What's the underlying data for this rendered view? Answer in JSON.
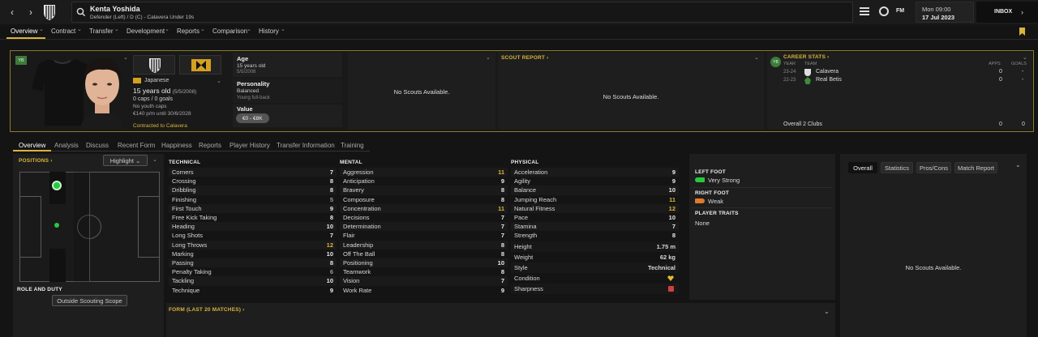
{
  "header": {
    "name": "Kenta Yoshida",
    "subtitle": "Defender (Left) / D (C) - Calavera Under 19s",
    "fm_label": "FM",
    "time": "Mon 09:00",
    "date": "17 Jul 2023",
    "inbox": "INBOX"
  },
  "subnav": [
    "Overview",
    "Contract",
    "Transfer",
    "Development",
    "Reports",
    "Comparison",
    "History"
  ],
  "profile": {
    "yb_badge": "YB",
    "nationality": "Japanese",
    "age_line": "15 years old",
    "dob_short": "(5/5/2008)",
    "caps": "0 caps / 0 goals",
    "youth_caps": "No youth caps",
    "contract_wage": "€140 p/m until 30/6/2028",
    "contracted_to": "Contracted to Calavera"
  },
  "info": {
    "age_label": "Age",
    "age_value": "15 years old",
    "age_dob": "5/5/2008",
    "personality_label": "Personality",
    "personality_value": "Balanced",
    "personality_sub": "Young full-back",
    "value_label": "Value",
    "value_amount": "€0 - €8K"
  },
  "scouts_panel1": "No Scouts Available.",
  "scout_report": {
    "title": "SCOUT REPORT",
    "empty": "No Scouts Available."
  },
  "career": {
    "badge": "YB",
    "title": "CAREER STATS",
    "col_year": "YEAR",
    "col_team": "TEAM",
    "col_apps": "APPS",
    "col_goals": "GOALS",
    "rows": [
      {
        "year": "23-24",
        "team": "Calavera",
        "apps": "0",
        "goals": "-"
      },
      {
        "year": "22-23",
        "team": "Real Betis",
        "apps": "0",
        "goals": "-"
      }
    ],
    "overall_label": "Overall 2 Clubs",
    "overall_apps": "0",
    "overall_goals": "0"
  },
  "tabs": [
    "Overview",
    "Analysis",
    "Discuss",
    "Recent Form",
    "Happiness",
    "Reports",
    "Player History",
    "Transfer Information",
    "Training"
  ],
  "positions": {
    "title": "POSITIONS",
    "highlight": "Highlight",
    "role_title": "ROLE AND DUTY",
    "scope_button": "Outside Scouting Scope"
  },
  "technical": {
    "title": "TECHNICAL",
    "rows": [
      {
        "name": "Corners",
        "value": "7"
      },
      {
        "name": "Crossing",
        "value": "8"
      },
      {
        "name": "Dribbling",
        "value": "8"
      },
      {
        "name": "Finishing",
        "value": "5"
      },
      {
        "name": "First Touch",
        "value": "9"
      },
      {
        "name": "Free Kick Taking",
        "value": "8"
      },
      {
        "name": "Heading",
        "value": "10"
      },
      {
        "name": "Long Shots",
        "value": "7"
      },
      {
        "name": "Long Throws",
        "value": "12"
      },
      {
        "name": "Marking",
        "value": "10"
      },
      {
        "name": "Passing",
        "value": "8"
      },
      {
        "name": "Penalty Taking",
        "value": "6"
      },
      {
        "name": "Tackling",
        "value": "10"
      },
      {
        "name": "Technique",
        "value": "9"
      }
    ]
  },
  "mental": {
    "title": "MENTAL",
    "rows": [
      {
        "name": "Aggression",
        "value": "11"
      },
      {
        "name": "Anticipation",
        "value": "9"
      },
      {
        "name": "Bravery",
        "value": "8"
      },
      {
        "name": "Composure",
        "value": "8"
      },
      {
        "name": "Concentration",
        "value": "11"
      },
      {
        "name": "Decisions",
        "value": "7"
      },
      {
        "name": "Determination",
        "value": "7"
      },
      {
        "name": "Flair",
        "value": "7"
      },
      {
        "name": "Leadership",
        "value": "8"
      },
      {
        "name": "Off The Ball",
        "value": "8"
      },
      {
        "name": "Positioning",
        "value": "10"
      },
      {
        "name": "Teamwork",
        "value": "8"
      },
      {
        "name": "Vision",
        "value": "7"
      },
      {
        "name": "Work Rate",
        "value": "9"
      }
    ]
  },
  "physical": {
    "title": "PHYSICAL",
    "rows": [
      {
        "name": "Acceleration",
        "value": "9"
      },
      {
        "name": "Agility",
        "value": "9"
      },
      {
        "name": "Balance",
        "value": "10"
      },
      {
        "name": "Jumping Reach",
        "value": "11"
      },
      {
        "name": "Natural Fitness",
        "value": "12"
      },
      {
        "name": "Pace",
        "value": "10"
      },
      {
        "name": "Stamina",
        "value": "7"
      },
      {
        "name": "Strength",
        "value": "8"
      }
    ],
    "height_label": "Height",
    "height_value": "1.75 m",
    "weight_label": "Weight",
    "weight_value": "62 kg",
    "style_label": "Style",
    "style_value": "Technical",
    "condition_label": "Condition",
    "sharpness_label": "Sharpness"
  },
  "feet": {
    "left_title": "LEFT FOOT",
    "left_value": "Very Strong",
    "right_title": "RIGHT FOOT",
    "right_value": "Weak",
    "traits_title": "PLAYER TRAITS",
    "traits_value": "None"
  },
  "form": {
    "title": "FORM (LAST 20 MATCHES)"
  },
  "right_tabs": [
    "Overall",
    "Statistics",
    "Pros/Cons",
    "Match Report"
  ],
  "right_empty": "No Scouts Available.",
  "colors": {
    "accent": "#d9b43b",
    "green": "#27c93f",
    "high": "#d9b43b",
    "bg": "#141414",
    "panel": "#1e1e1e"
  }
}
